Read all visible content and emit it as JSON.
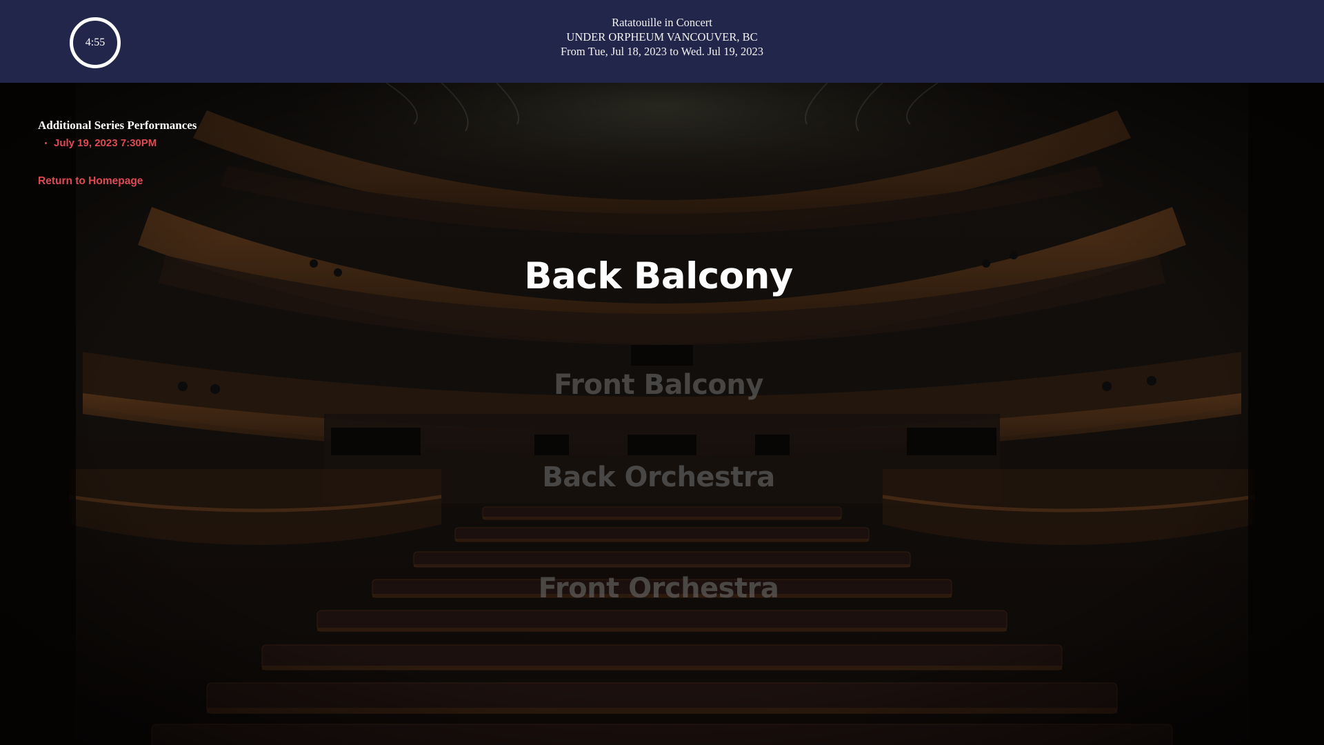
{
  "header": {
    "timer": "4:55",
    "event_title": "Ratatouille in Concert",
    "venue": "UNDER ORPHEUM VANCOUVER, BC",
    "dates": "From Tue, Jul 18, 2023 to Wed. Jul 19, 2023",
    "background_color": "#22264a"
  },
  "sidebar": {
    "series_title": "Additional Series Performances",
    "performances": [
      {
        "label": "July 19, 2023 7:30PM"
      }
    ],
    "return_label": "Return to Homepage",
    "link_color": "#e04a52"
  },
  "sections": {
    "selected": "Back Balcony",
    "options": [
      {
        "label": "Back Balcony",
        "state": "selected"
      },
      {
        "label": "Front Balcony",
        "state": "unselected"
      },
      {
        "label": "Back Orchestra",
        "state": "unselected"
      },
      {
        "label": "Front Orchestra",
        "state": "unselected"
      }
    ]
  },
  "icons": {
    "timer": "countdown-ring-icon",
    "bullet": "bullet-dot-icon"
  }
}
